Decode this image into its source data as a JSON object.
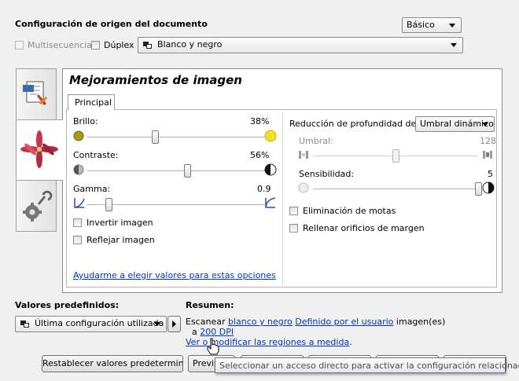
{
  "header": {
    "title": "Configuración de origen del documento",
    "mode_select": "Básico",
    "multifeed_label": "Multisecuencia",
    "duplex_label": "Dúplex",
    "color_select": "Blanco y negro"
  },
  "panel": {
    "title": "Mejoramientos de imagen",
    "tab_label": "Principal",
    "brightness": {
      "label": "Brillo:",
      "value": "38%",
      "level": 0.38
    },
    "contrast": {
      "label": "Contraste:",
      "value": "56%",
      "level": 0.56
    },
    "gamma": {
      "label": "Gamma:",
      "value": "0.9",
      "level": 0.12
    },
    "invert_label": "Invertir imagen",
    "mirror_label": "Reflejar imagen",
    "help_link": "Ayudarme a elegir valores para estas opciones",
    "bit_depth": {
      "label": "Reducción de profundidad de bits:",
      "select": "Umbral dinámico"
    },
    "threshold": {
      "label": "Umbral:",
      "value": "128",
      "level": 0.5
    },
    "sensitivity": {
      "label": "Sensibilidad:",
      "value": "5",
      "level": 1.0
    },
    "despeckle_label": "Eliminación de motas",
    "fill_holes_label": "Rellenar orificios de margen"
  },
  "presets": {
    "label": "Valores predefinidos:",
    "select": "Última configuración utilizada"
  },
  "summary": {
    "label": "Resumen:",
    "line1_prefix": "Escanear ",
    "link_color": "blanco y negro",
    "link_user": "Definido por el usuario",
    "line1_suffix": " imagen(es)",
    "line2_prefix": "a ",
    "link_dpi": "200 DPI",
    "link_regions": "Ver o modificar las regiones a medida",
    "line3_suffix": "."
  },
  "buttons": {
    "reset": "Restablecer valores predeterminados",
    "preview": "Previs"
  },
  "tooltip": "Seleccionar un acceso directo para activar la configuración relacionada",
  "colors": {
    "link": "#0033cc",
    "sun": "#e8d400",
    "panel_border": "#8c8c8c"
  }
}
